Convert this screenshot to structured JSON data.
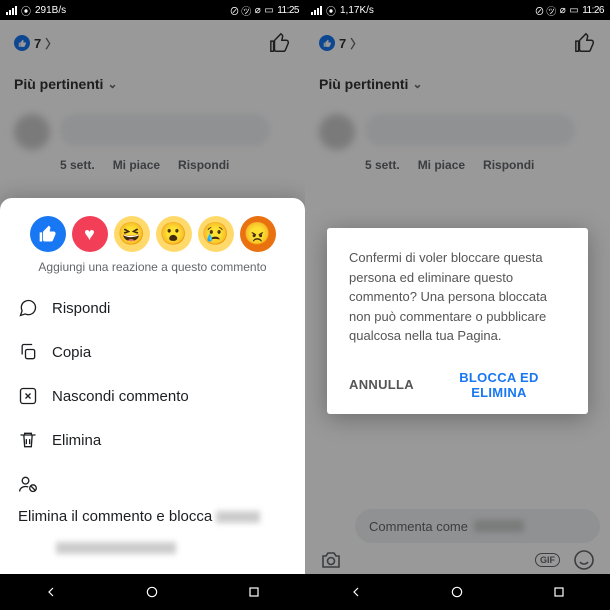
{
  "left": {
    "statusbar": {
      "speed": "291B/s",
      "time": "11:25"
    },
    "likes": "7",
    "sort": "Più pertinenti",
    "comment_meta": {
      "age": "5 sett.",
      "like": "Mi piace",
      "reply": "Rispondi"
    },
    "sheet": {
      "reaction_hint": "Aggiungi una reazione a questo commento",
      "reactions": [
        "like",
        "love",
        "haha",
        "wow",
        "sad",
        "angry"
      ],
      "actions": {
        "reply": "Rispondi",
        "copy": "Copia",
        "hide": "Nascondi commento",
        "delete": "Elimina",
        "block": "Elimina il commento e blocca"
      }
    }
  },
  "right": {
    "statusbar": {
      "speed": "1,17K/s",
      "time": "11:26"
    },
    "likes": "7",
    "sort": "Più pertinenti",
    "comment_meta": {
      "age": "5 sett.",
      "like": "Mi piace",
      "reply": "Rispondi"
    },
    "dialog": {
      "text": "Confermi di voler bloccare questa persona ed eliminare questo commento? Una persona bloccata non può commentare o pubblicare qualcosa nella tua Pagina.",
      "cancel": "ANNULLA",
      "confirm": "BLOCCA ED ELIMINA"
    },
    "input": {
      "placeholder": "Commenta come",
      "gif": "GIF"
    }
  }
}
